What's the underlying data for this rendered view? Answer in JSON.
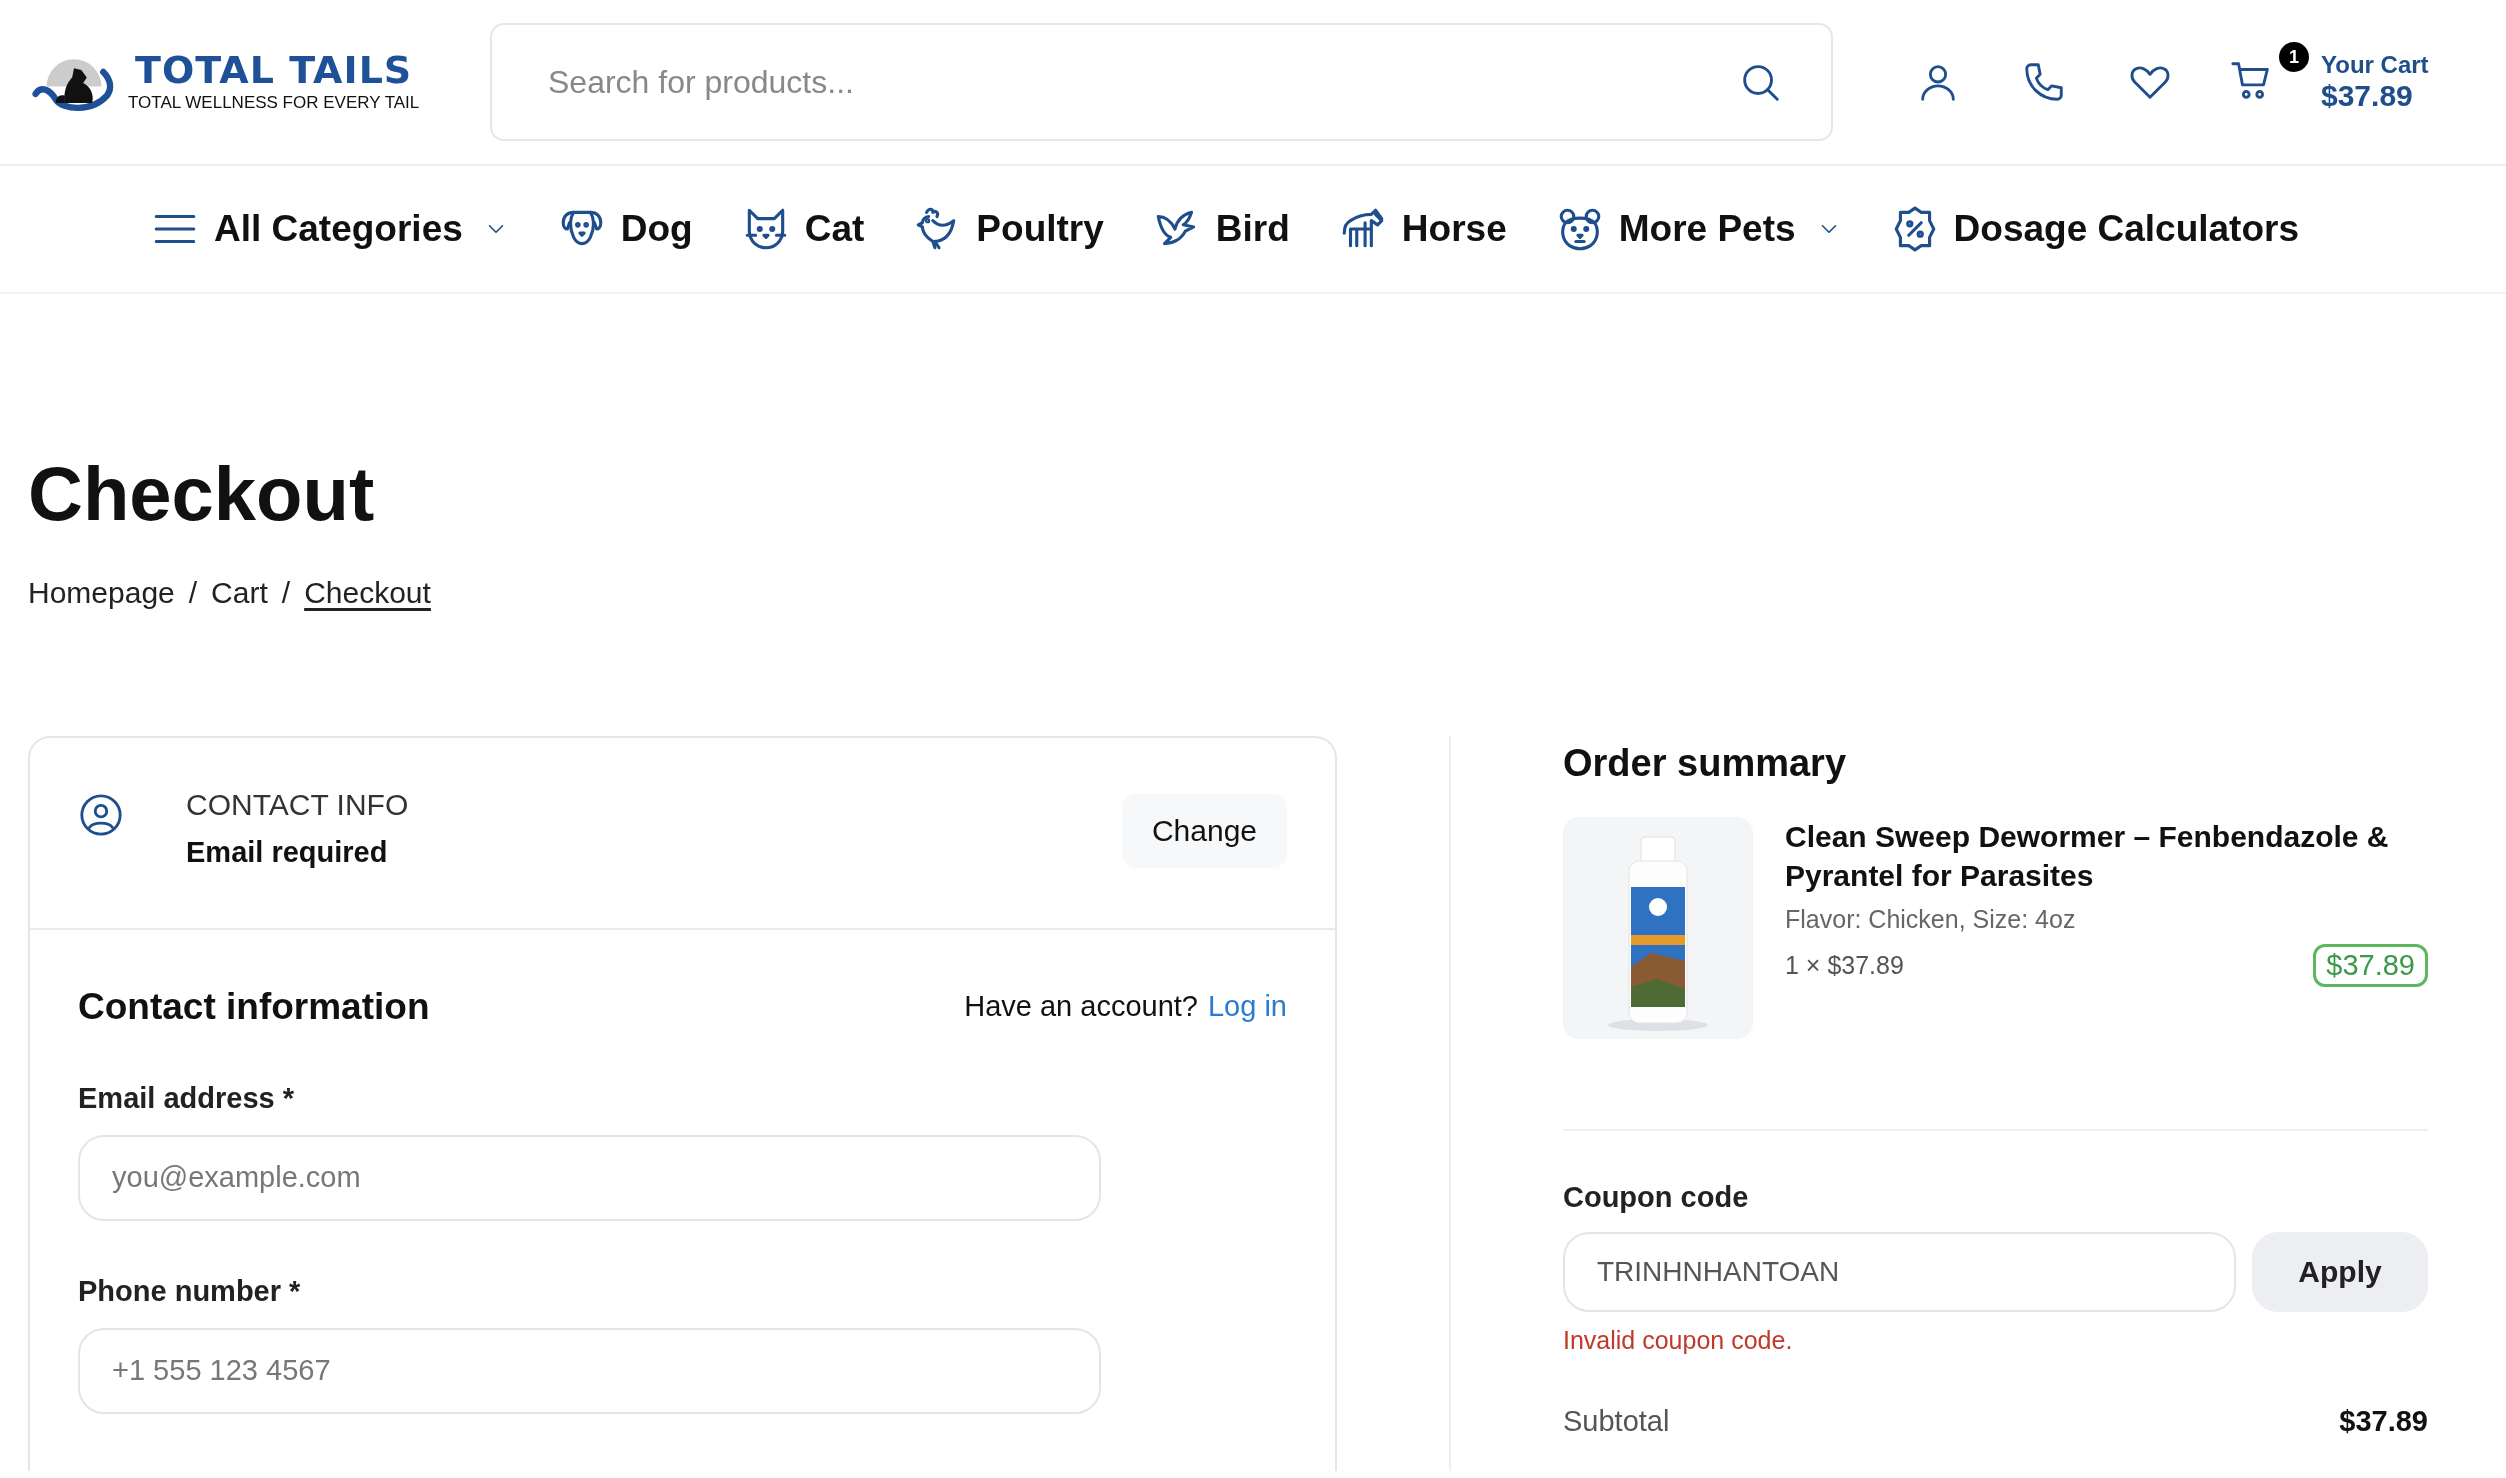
{
  "header": {
    "logo": {
      "name": "TOTAL TAILS",
      "tagline": "TOTAL WELLNESS FOR EVERY TAIL"
    },
    "search": {
      "placeholder": "Search for products..."
    },
    "actions": [
      {
        "kind": "account"
      },
      {
        "kind": "phone"
      },
      {
        "kind": "wishlist"
      }
    ],
    "cart": {
      "count": "1",
      "label": "Your Cart",
      "total": "$37.89"
    }
  },
  "nav": [
    {
      "kind": "menu",
      "label": "All Categories",
      "dropdown": true
    },
    {
      "kind": "dog",
      "label": "Dog",
      "dropdown": false
    },
    {
      "kind": "cat",
      "label": "Cat",
      "dropdown": false
    },
    {
      "kind": "poultry",
      "label": "Poultry",
      "dropdown": false
    },
    {
      "kind": "bird",
      "label": "Bird",
      "dropdown": false
    },
    {
      "kind": "horse",
      "label": "Horse",
      "dropdown": false
    },
    {
      "kind": "hamster",
      "label": "More Pets",
      "dropdown": true
    },
    {
      "kind": "percent",
      "label": "Dosage Calculators",
      "dropdown": false
    }
  ],
  "page_title": "Checkout",
  "breadcrumb": {
    "items": [
      {
        "label": "Homepage",
        "selected": false
      },
      {
        "label": "Cart",
        "selected": false
      },
      {
        "label": "Checkout",
        "selected": true
      }
    ],
    "separators": [
      "/",
      "/"
    ]
  },
  "contact_step": {
    "heading": "CONTACT INFO",
    "status": "Email required",
    "button": "Change"
  },
  "contact_form": {
    "title": "Contact information",
    "account_prompt": "Have an account?",
    "login_link": "Log in",
    "fields": [
      {
        "label": "Email address *",
        "placeholder": "you@example.com"
      },
      {
        "label": "Phone number *",
        "placeholder": "+1 555 123 4567"
      }
    ]
  },
  "order_summary": {
    "title": "Order summary",
    "items": [
      {
        "name": "Clean Sweep Dewormer – Fenbendazole & Pyrantel for Parasites",
        "variant": "Flavor: Chicken, Size: 4oz",
        "quantity_price": "1 × $37.89",
        "total": "$37.89"
      }
    ],
    "coupon": {
      "label": "Coupon code",
      "value": "TRINHNHANTOAN",
      "button": "Apply",
      "error": "Invalid coupon code."
    },
    "totals": [
      {
        "label": "Subtotal",
        "value": "$37.89"
      }
    ]
  }
}
